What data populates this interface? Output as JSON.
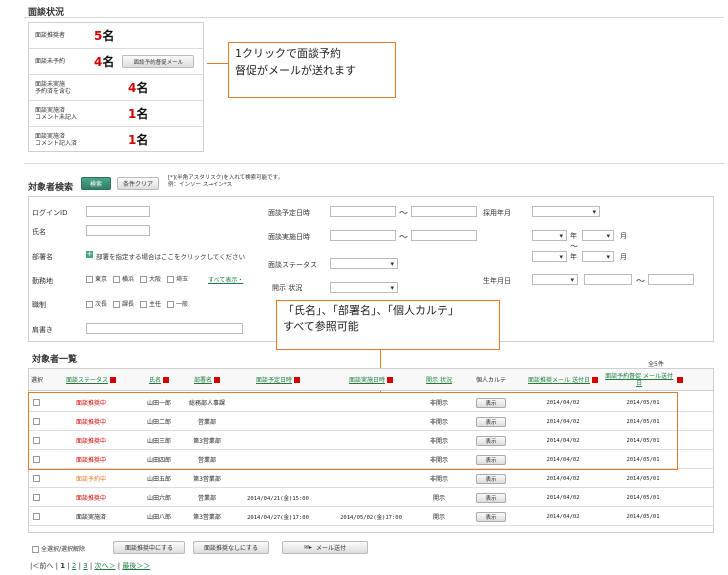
{
  "summary": {
    "title": "面談状況",
    "rows": [
      {
        "label": "面談推奨者",
        "count": "5",
        "unit": "名"
      },
      {
        "label": "面談未予約",
        "count": "4",
        "unit": "名",
        "button": "面談予約督促メール"
      },
      {
        "label": "面談未実施\n予約済を含む",
        "count": "4",
        "unit": "名"
      },
      {
        "label": "面談実施済\nコメント未記入",
        "count": "1",
        "unit": "名"
      },
      {
        "label": "面談実施済\nコメント記入済",
        "count": "1",
        "unit": "名"
      }
    ]
  },
  "callouts": {
    "c1_line1": "1クリックで面談予約",
    "c1_line2": "督促がメールが送れます",
    "c2_line1": "「氏名」、「部署名」、「個人カルテ」",
    "c2_line2": "すべて参照可能"
  },
  "search": {
    "title": "対象者検索",
    "search_button": "検索",
    "clear_button": "条件クリア",
    "hint_line1": "[*](半角アスタリスク)を入れて検索可能です。",
    "hint_line2": "例：インソー ス→イン*ス",
    "login_id": "ログインID",
    "name": "氏名",
    "dept": "部署名",
    "dept_hint": "部署を指定する場合はここをクリックしてください",
    "workplace": "勤務地",
    "workplace_opts": [
      "東京",
      "横浜",
      "大阪",
      "埼玉"
    ],
    "show_all": "すべて表示・",
    "position": "職制",
    "position_opts": [
      "次長",
      "課長",
      "主任",
      "一般"
    ],
    "title_label": "肩書き",
    "interview_planned": "面談予定日時",
    "interview_done": "面談実施日時",
    "interview_status": "面談ステータス",
    "open_status": "開示 状況",
    "tilde": "～",
    "hire_year": "採用年月",
    "year": "年",
    "month": "月",
    "birth": "生年月日"
  },
  "list": {
    "title": "対象者一覧",
    "total": "全5件",
    "headers": {
      "select": "選択",
      "status": "面談ステータス",
      "name": "氏名",
      "dept": "部署名",
      "planned": "面談予定日時",
      "done": "面談実施日時",
      "open": "開示 状況",
      "karte": "個人カルテ",
      "mail_sent": "面談推奨メール 送付日",
      "remind_sent": "面談予約督促 メール送付日"
    },
    "rows": [
      {
        "status": "面談推奨中",
        "status_color": "#d40000",
        "name": "山田一郎",
        "dept": "総務部人事課",
        "planned": "",
        "done": "",
        "open": "非開示",
        "karte": "表示",
        "mail": "2014/04/02",
        "remind": "2014/05/01"
      },
      {
        "status": "面談推奨中",
        "status_color": "#d40000",
        "name": "山田二郎",
        "dept": "営業部",
        "planned": "",
        "done": "",
        "open": "非開示",
        "karte": "表示",
        "mail": "2014/04/02",
        "remind": "2014/05/01"
      },
      {
        "status": "面談推奨中",
        "status_color": "#d40000",
        "name": "山田三郎",
        "dept": "第3営業部",
        "planned": "",
        "done": "",
        "open": "非開示",
        "karte": "表示",
        "mail": "2014/04/02",
        "remind": "2014/05/01"
      },
      {
        "status": "面談推奨中",
        "status_color": "#d40000",
        "name": "山田四郎",
        "dept": "営業部",
        "planned": "",
        "done": "",
        "open": "非開示",
        "karte": "表示",
        "mail": "2014/04/02",
        "remind": "2014/05/01"
      },
      {
        "status": "面談予約中",
        "status_color": "#e87722",
        "name": "山田五郎",
        "dept": "第3営業部",
        "planned": "",
        "done": "",
        "open": "非開示",
        "karte": "表示",
        "mail": "2014/04/02",
        "remind": "2014/05/01"
      },
      {
        "status": "面談推奨中",
        "status_color": "#d40000",
        "name": "山田六郎",
        "dept": "営業部",
        "planned": "2014/04/21(金)15:00",
        "done": "",
        "open": "開示",
        "karte": "表示",
        "mail": "2014/04/02",
        "remind": "2014/05/01"
      },
      {
        "status": "面談実施済",
        "status_color": "#222222",
        "name": "山田八郎",
        "dept": "第3営業部",
        "planned": "2014/04/27(金)17:00",
        "done": "2014/05/02(金)17:00",
        "open": "開示",
        "karte": "表示",
        "mail": "2014/04/02",
        "remind": "2014/05/01"
      }
    ],
    "select_all": "全選択/選択解除",
    "btn_recommend": "面談推奨中にする",
    "btn_none": "面談推奨なしにする",
    "btn_mail": "メール送付",
    "pager": {
      "prev": "|＜前へ",
      "p1": "1",
      "p2": "2",
      "p3": "3",
      "next": "次へ＞",
      "last": "最後＞＞"
    }
  }
}
